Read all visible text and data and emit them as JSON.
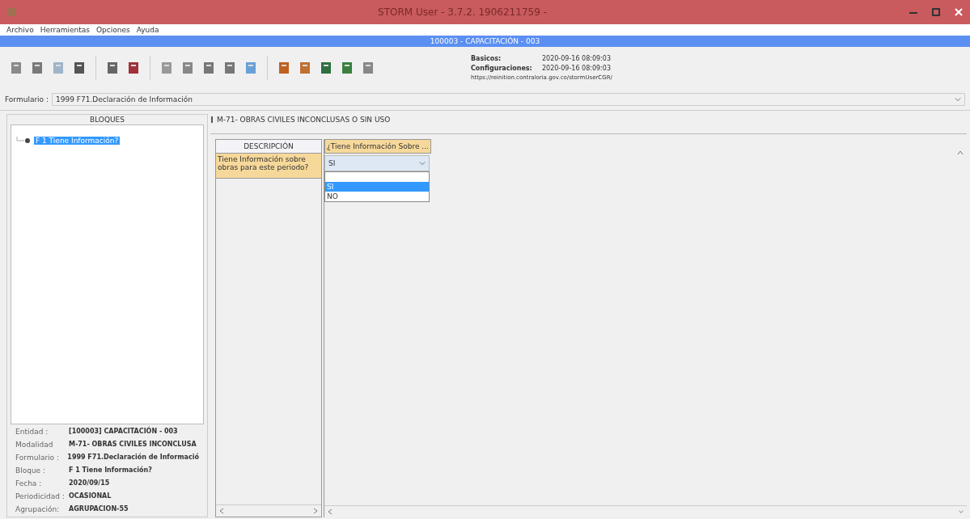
{
  "window": {
    "title": "STORM User - 3.7.2. 1906211759 -"
  },
  "menu": [
    "Archivo",
    "Herramientas",
    "Opciones",
    "Ayuda"
  ],
  "entity_bar": "100003 - CAPACITACIÓN - 003",
  "info": {
    "rows": [
      {
        "label": "Basicos:",
        "value": "2020-09-16 08:09:03"
      },
      {
        "label": "Configuraciones:",
        "value": "2020-09-16 08:09:03"
      }
    ],
    "url": "https://reinition.contraloria.gov.co/stormUserCGR/"
  },
  "formulario": {
    "label": "Formulario :",
    "value": "1999 F71.Declaración de Información"
  },
  "bloques": {
    "title": "BLOQUES",
    "tree": [
      {
        "label": "F 1 Tiene Información?",
        "selected": true
      }
    ]
  },
  "details": [
    {
      "label": "Entidad :",
      "value": "[100003] CAPACITACIÓN - 003"
    },
    {
      "label": "Modalidad",
      "value": "M-71- OBRAS CIVILES INCONCLUSA"
    },
    {
      "label": "Formulario :",
      "value": "1999 F71.Declaración de Informació"
    },
    {
      "label": "Bloque :",
      "value": "F 1 Tiene Información?"
    },
    {
      "label": "Fecha :",
      "value": "2020/09/15"
    },
    {
      "label": "Periodicidad :",
      "value": "OCASIONAL"
    },
    {
      "label": "Agrupación:",
      "value": "AGRUPACION-55"
    }
  ],
  "section_title": "M-71- OBRAS CIVILES INCONCLUSAS O SIN USO",
  "grid": {
    "description_header": "DESCRIPCIÓN",
    "description": "Tiene Información sobre obras para este periodo?",
    "column_header": "¿Tiene Información Sobre ...",
    "combo": {
      "value": "SI",
      "expanded": true,
      "options": [
        {
          "selected": false
        },
        {
          "label": "SI",
          "selected": true
        },
        {
          "label": "NO",
          "selected": false
        }
      ]
    }
  }
}
